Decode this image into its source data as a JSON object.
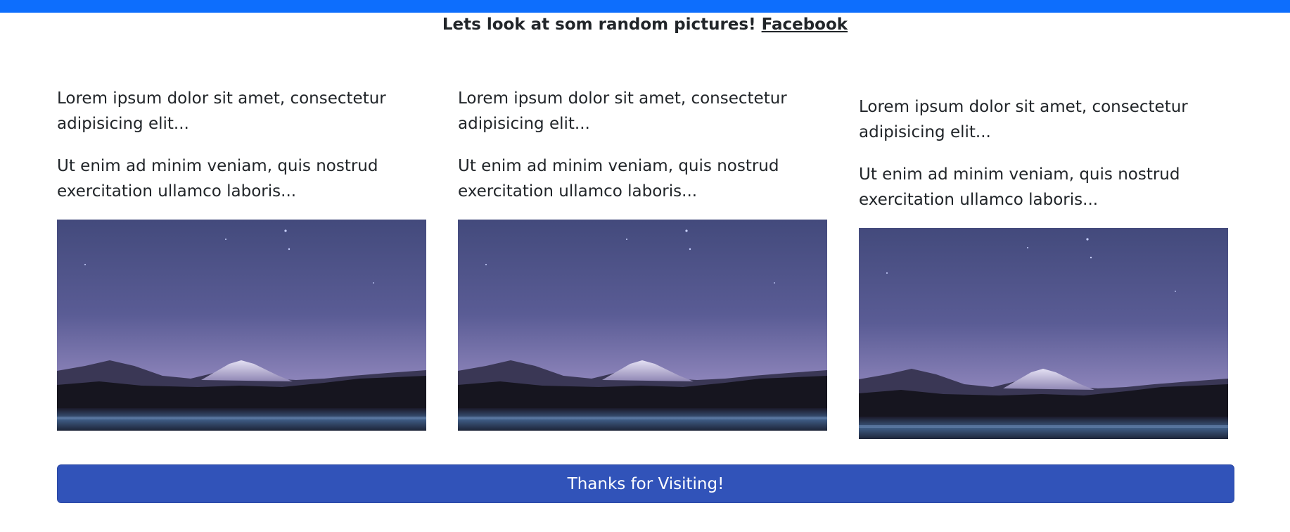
{
  "header": {
    "text": "Lets look at som random pictures!",
    "link_label": "Facebook",
    "bar_color": "#0d6efd"
  },
  "cards": [
    {
      "paragraph_1": "Lorem ipsum dolor sit amet, consectetur adipisicing elit...",
      "paragraph_2": "Ut enim ad minim veniam, quis nostrud exercitation ullamco laboris..."
    },
    {
      "paragraph_1": "Lorem ipsum dolor sit amet, consectetur adipisicing elit...",
      "paragraph_2": "Ut enim ad minim veniam, quis nostrud exercitation ullamco laboris..."
    },
    {
      "paragraph_1": "Lorem ipsum dolor sit amet, consectetur adipisicing elit...",
      "paragraph_2": "Ut enim ad minim veniam, quis nostrud exercitation ullamco laboris..."
    }
  ],
  "footer": {
    "button_label": "Thanks for Visiting!",
    "button_color": "#3153b9"
  }
}
